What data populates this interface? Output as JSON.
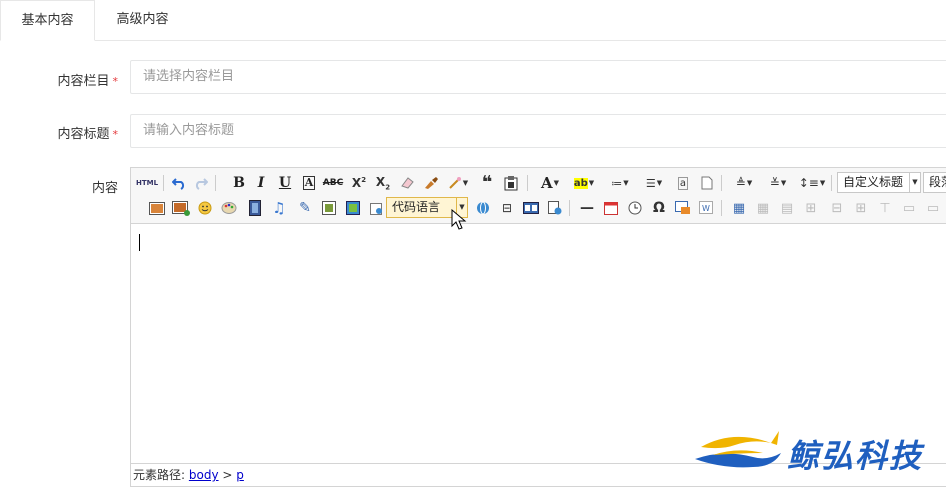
{
  "tabs": [
    {
      "label": "基本内容",
      "active": true
    },
    {
      "label": "高级内容",
      "active": false
    }
  ],
  "form": {
    "category": {
      "label": "内容栏目",
      "required_mark": "*",
      "placeholder": "请选择内容栏目"
    },
    "title": {
      "label": "内容标题",
      "required_mark": "*",
      "placeholder": "请输入内容标题"
    },
    "content": {
      "label": "内容"
    }
  },
  "editor": {
    "toolbar": {
      "html_label": "HTML",
      "heading_combo": "自定义标题",
      "paragraph_combo": "段落",
      "code_combo": "代码语言"
    },
    "status": {
      "path_label": "元素路径:",
      "path_body": "body",
      "path_sep": ">",
      "path_p": "p"
    }
  },
  "watermark": {
    "text": "鲸弘科技"
  },
  "colors": {
    "required": "#e4393c",
    "watermark_blue": "#1f5fbf",
    "watermark_gold": "#f0b400",
    "link": "#0000cc"
  }
}
